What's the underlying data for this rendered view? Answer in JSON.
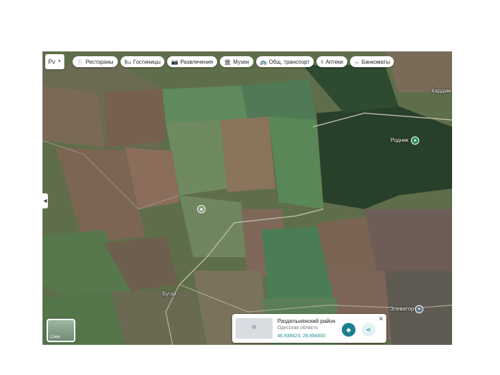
{
  "lang_button": "Рv",
  "categories": [
    {
      "label": "Рестораны",
      "icon": "restaurant-icon",
      "glyph": "🍴"
    },
    {
      "label": "Гостиницы",
      "icon": "hotel-icon",
      "glyph": "🛏"
    },
    {
      "label": "Развлечения",
      "icon": "camera-icon",
      "glyph": "📷"
    },
    {
      "label": "Музеи",
      "icon": "museum-icon",
      "glyph": "🏛"
    },
    {
      "label": "Общ. транспорт",
      "icon": "bus-icon",
      "glyph": "🚌"
    },
    {
      "label": "Аптеки",
      "icon": "pharmacy-icon",
      "glyph": "⚕"
    },
    {
      "label": "Банкоматы",
      "icon": "atm-icon",
      "glyph": "↔"
    }
  ],
  "places": {
    "kardam": "Кардам",
    "rodnik": "Родник",
    "bugai": "Бугай",
    "elevator": "Элеватор"
  },
  "layers_label": "Слои",
  "card": {
    "title": "Раздельнянский район",
    "subtitle": "Одесская область",
    "coords": "46.939423, 29.856600"
  },
  "colors": {
    "accent": "#1a7f8c",
    "poi_green": "#2f8f5a"
  }
}
